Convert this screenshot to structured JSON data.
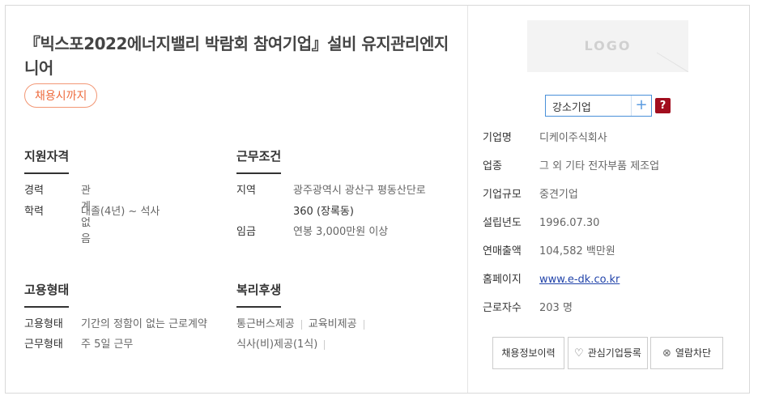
{
  "job": {
    "title": "『빅스포2022에너지밸리 박람회 참여기업』설비 유지관리엔지니어",
    "deadline_badge": "채용시까지"
  },
  "qualification": {
    "title": "지원자격",
    "items": [
      {
        "label": "경력",
        "value": "관계없음"
      },
      {
        "label": "학력",
        "value": "대졸(4년) ~ 석사"
      }
    ]
  },
  "conditions": {
    "title": "근무조건",
    "location_label": "지역",
    "location_value_line1": "광주광역시 광산구 평동산단로",
    "location_value_line2": "360 (장록동)",
    "salary_label": "임금",
    "salary_value": "연봉 3,000만원 이상"
  },
  "employment": {
    "title": "고용형태",
    "items": [
      {
        "label": "고용형태",
        "value": "기간의 정함이 없는 근로계약"
      },
      {
        "label": "근무형태",
        "value": "주 5일 근무"
      }
    ]
  },
  "welfare": {
    "title": "복리후생",
    "items": [
      "통근버스제공",
      "교육비제공",
      "식사(비)제공(1식)"
    ]
  },
  "company": {
    "logo_text": "LOGO",
    "tag_label": "강소기업",
    "tag_add": "+",
    "help": "?",
    "info": [
      {
        "label": "기업명",
        "value": "디케이주식회사"
      },
      {
        "label": "업종",
        "value": "그 외 기타 전자부품 제조업"
      },
      {
        "label": "기업규모",
        "value": "중견기업"
      },
      {
        "label": "설립년도",
        "value": "1996.07.30"
      },
      {
        "label": "연매출액",
        "value": "104,582 백만원"
      },
      {
        "label": "홈페이지",
        "value": "www.e-dk.co.kr"
      },
      {
        "label": "근로자수",
        "value": "203 명"
      }
    ],
    "buttons": {
      "history": "채용정보이력",
      "favorite": "관심기업등록",
      "block": "열람차단"
    }
  }
}
